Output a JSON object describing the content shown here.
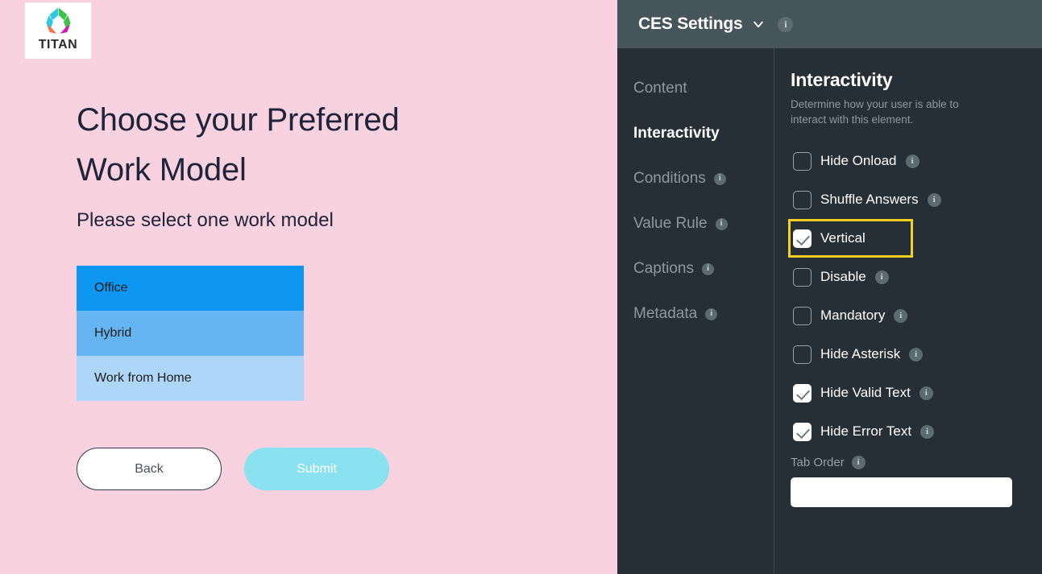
{
  "form": {
    "logo": {
      "wordmark": "TITAN",
      "icon": "titan-logo-icon"
    },
    "title": "Choose your Preferred Work Model",
    "subtitle": "Please select one work model",
    "options": [
      {
        "label": "Office",
        "color": "#0d96f2"
      },
      {
        "label": "Hybrid",
        "color": "#64b5f2"
      },
      {
        "label": "Work from Home",
        "color": "#aed6f8"
      }
    ],
    "buttons": {
      "back": "Back",
      "submit": "Submit"
    },
    "background_color": "#f8d3df"
  },
  "settings": {
    "header": {
      "title": "CES Settings",
      "chevron_icon": "chevron-down-icon",
      "info_icon": "info-icon",
      "background_color": "#46545c"
    },
    "nav": [
      {
        "label": "Content",
        "active": false,
        "has_info": false
      },
      {
        "label": "Interactivity",
        "active": true,
        "has_info": false
      },
      {
        "label": "Conditions",
        "active": false,
        "has_info": true
      },
      {
        "label": "Value Rule",
        "active": false,
        "has_info": true
      },
      {
        "label": "Captions",
        "active": false,
        "has_info": true
      },
      {
        "label": "Metadata",
        "active": false,
        "has_info": true
      }
    ],
    "detail": {
      "title": "Interactivity",
      "description": "Determine how your user is able to interact with this element.",
      "checkboxes": [
        {
          "label": "Hide Onload",
          "checked": false,
          "has_info": true,
          "highlighted": false
        },
        {
          "label": "Shuffle Answers",
          "checked": false,
          "has_info": true,
          "highlighted": false
        },
        {
          "label": "Vertical",
          "checked": true,
          "has_info": false,
          "highlighted": true
        },
        {
          "label": "Disable",
          "checked": false,
          "has_info": true,
          "highlighted": false
        },
        {
          "label": "Mandatory",
          "checked": false,
          "has_info": true,
          "highlighted": false
        },
        {
          "label": "Hide Asterisk",
          "checked": false,
          "has_info": true,
          "highlighted": false
        },
        {
          "label": "Hide Valid Text",
          "checked": true,
          "has_info": true,
          "highlighted": false
        },
        {
          "label": "Hide Error Text",
          "checked": true,
          "has_info": true,
          "highlighted": false
        }
      ],
      "tab_order": {
        "label": "Tab Order",
        "has_info": true,
        "value": "",
        "placeholder": ""
      }
    },
    "background_color": "#262f36",
    "highlight_color": "#f5d022"
  }
}
